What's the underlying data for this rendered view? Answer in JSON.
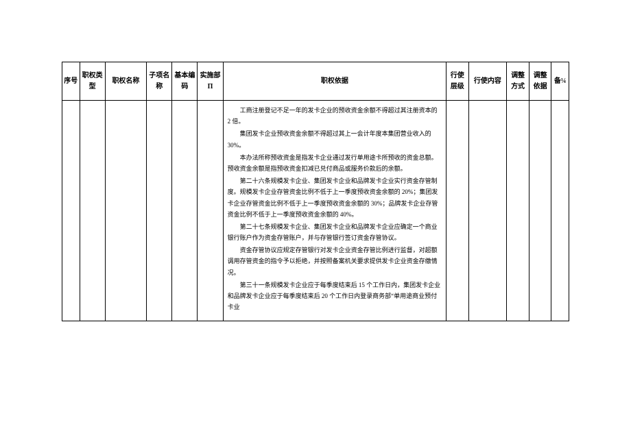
{
  "headers": {
    "seq": "序号",
    "type": "职权类型",
    "name": "职权名称",
    "sub": "子项名称",
    "code": "基本编码",
    "dept": "实施部 Π",
    "basis": "职权依据",
    "level": "行使层级",
    "exec": "行使内容",
    "adjm": "调整方式",
    "adjb": "调整依据",
    "rem": "备¼"
  },
  "row": {
    "seq": "",
    "type": "",
    "name": "",
    "sub": "",
    "code": "",
    "dept": "",
    "basis": [
      "工商注册登记不足一年的发卡企业的预收资金余额不得超过其注册资本的 2 倍。",
      "集团发卡企业预收资金余额不得超过其上一会计年度本集团营业收入的 30%。",
      "本办法所称预收资金是指发卡企业通过发行单用途卡所预收的资金总额。预收资金余额是指预收资金扣减已兑付商品或服务价款后的余额。",
      "第二十六条规模发卡企业、集团发卡企业和品牌发卡企业实行资金存管制度。规模发卡企业存管资金比例不低于上一季度预收资金余额的 20%；集团发卡企业存管资金比例不低于上一季度预收资金余额的 30%；品牌发卡企业存管资金比例不低于上一季度预收资金余额的 40%。",
      "第二十七条规模发卡企业、集团发卡企业和品牌发卡企业应确定一个商业银行账户作为资金存管账户，并与存管银行签订资金存管协议。",
      "资金存管协议应规定存管银行对发卡企业资金存管比例进行监督，对超额调用存管资金的指令予以拒绝，并按照备案机关要求提供发卡企业资金存缴情况。",
      "第三十一条规模发卡企业应于每季度结束后 15 个工作日内，集团发卡企业和品牌发卡企业应于每季度结束后 20 个工作日内登录商务部“单用途商业预付卡业"
    ],
    "level": "",
    "exec": "",
    "adjm": "",
    "adjb": "",
    "rem": ""
  }
}
